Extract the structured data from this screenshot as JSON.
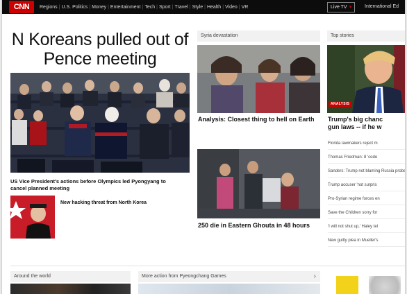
{
  "nav": {
    "logo": "CNN",
    "items": [
      "Regions",
      "U.S. Politics",
      "Money",
      "Entertainment",
      "Tech",
      "Sport",
      "Travel",
      "Style",
      "Health",
      "Video",
      "VR"
    ],
    "live_tv": "Live TV",
    "edition": "International Ed"
  },
  "hero": {
    "headline": "N Koreans pulled out of Pence meeting",
    "caption": "US Vice President's actions before Olympics led Pyongyang to cancel planned meeting"
  },
  "kim_story": {
    "caption": "New hacking threat from North Korea"
  },
  "syria": {
    "section": "Syria devastation",
    "caption1": "Analysis: Closest thing to hell on Earth",
    "caption2": "250 die in Eastern Ghouta in 48 hours"
  },
  "top_stories": {
    "section": "Top stories",
    "tag": "ANALYSIS",
    "headline_line1": "Trump's big chanc",
    "headline_line2": "gun laws -- if he w",
    "items": [
      "Florida lawmakers reject m",
      "Thomas Friedman: 8 'code",
      "Sanders: Trump not blaming Russia probe",
      "Trump accuser 'not surpris",
      "Pro-Syrian regime forces en",
      "Save the Children sorry for",
      "'I will not shut up,' Haley tel",
      "New guilty plea in Mueller's"
    ]
  },
  "bottom": {
    "world": "Around the world",
    "pyeongchang": "More action from Pyeongchang Games"
  },
  "colors": {
    "brand_red": "#cc0000",
    "nav_bg": "#0c0c0c"
  }
}
